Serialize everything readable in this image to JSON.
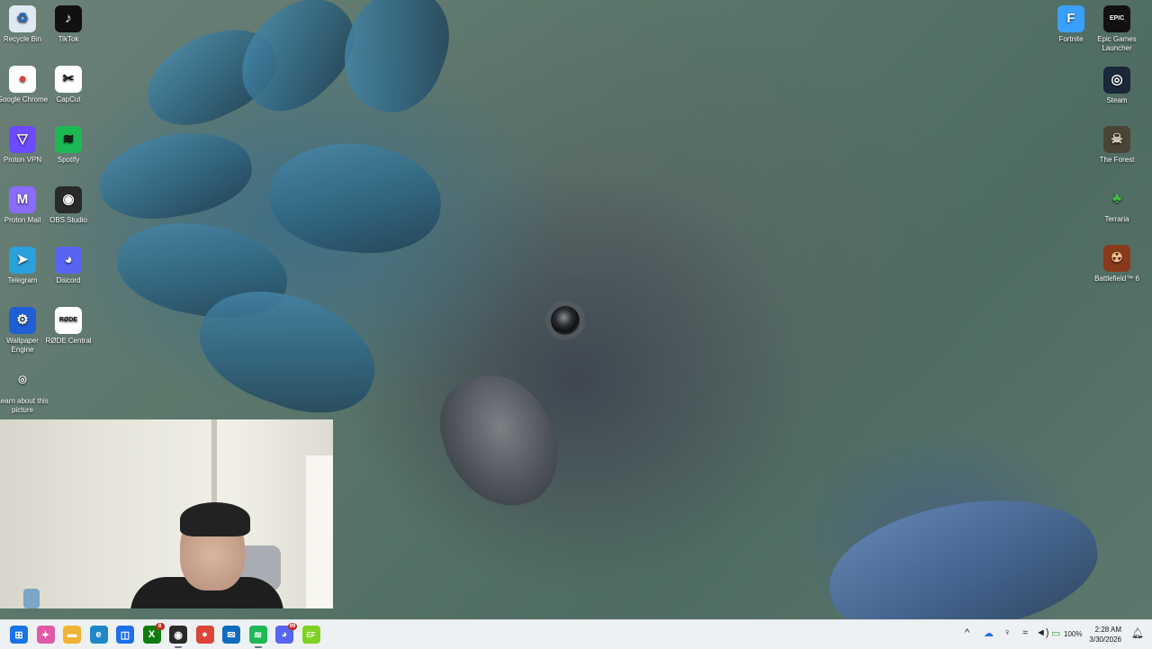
{
  "desktop": {
    "icons_left": [
      {
        "label": "Recycle Bin",
        "icon": "recycle-bin-icon",
        "glyph": "♻",
        "bg": "#dfe9f3",
        "fg": "#2b6cb0"
      },
      {
        "label": "TikTok",
        "icon": "tiktok-icon",
        "glyph": "♪",
        "bg": "#111111",
        "fg": "#ffffff"
      },
      {
        "label": "Google Chrome",
        "icon": "chrome-icon",
        "glyph": "●",
        "bg": "#ffffff",
        "fg": "#db4437"
      },
      {
        "label": "CapCut",
        "icon": "capcut-icon",
        "glyph": "✂",
        "bg": "#ffffff",
        "fg": "#111111"
      },
      {
        "label": "Proton VPN",
        "icon": "proton-vpn-icon",
        "glyph": "▽",
        "bg": "#6d4aff",
        "fg": "#ffffff"
      },
      {
        "label": "Spotify",
        "icon": "spotify-icon",
        "glyph": "≋",
        "bg": "#1db954",
        "fg": "#111111"
      },
      {
        "label": "Proton Mail",
        "icon": "proton-mail-icon",
        "glyph": "M",
        "bg": "#8a6cff",
        "fg": "#ffffff"
      },
      {
        "label": "OBS Studio",
        "icon": "obs-studio-icon",
        "glyph": "◉",
        "bg": "#2a2a2a",
        "fg": "#ffffff"
      },
      {
        "label": "Telegram",
        "icon": "telegram-icon",
        "glyph": "➤",
        "bg": "#2aa1da",
        "fg": "#ffffff"
      },
      {
        "label": "Discord",
        "icon": "discord-icon",
        "glyph": "◕",
        "bg": "#5865f2",
        "fg": "#ffffff"
      },
      {
        "label": "Wallpaper Engine",
        "icon": "wallpaper-engine-icon",
        "glyph": "⚙",
        "bg": "#1f5fd6",
        "fg": "#ffffff"
      },
      {
        "label": "RØDE Central",
        "icon": "rode-central-icon",
        "glyph": "RØDE",
        "bg": "#ffffff",
        "fg": "#111111"
      },
      {
        "label": "Learn about this picture",
        "icon": "learn-about-picture-icon",
        "glyph": "⌾",
        "bg": "transparent",
        "fg": "#ffffff"
      }
    ],
    "icons_right": [
      {
        "label": "Fortnite",
        "icon": "fortnite-icon",
        "glyph": "F",
        "bg": "#3aa0ff",
        "fg": "#ffffff"
      },
      {
        "label": "Epic Games Launcher",
        "icon": "epic-games-icon",
        "glyph": "EPIC",
        "bg": "#111111",
        "fg": "#ffffff"
      },
      {
        "label": "Steam",
        "icon": "steam-icon",
        "glyph": "◎",
        "bg": "#1b2838",
        "fg": "#ffffff"
      },
      {
        "label": "The Forest",
        "icon": "the-forest-icon",
        "glyph": "☠",
        "bg": "#4a4436",
        "fg": "#d9d2bc"
      },
      {
        "label": "Terraria",
        "icon": "terraria-icon",
        "glyph": "♣",
        "bg": "transparent",
        "fg": "#3fbf3f"
      },
      {
        "label": "Battlefield™ 6",
        "icon": "battlefield-icon",
        "glyph": "☢",
        "bg": "#8a3a1c",
        "fg": "#f2c28a"
      }
    ]
  },
  "taskbar": {
    "apps": [
      {
        "name": "start-button",
        "icon": "windows-icon",
        "glyph": "⊞",
        "bg": "#1a73e8",
        "open": false
      },
      {
        "name": "copilot-button",
        "icon": "copilot-icon",
        "glyph": "✦",
        "bg": "#e05aa8",
        "open": false
      },
      {
        "name": "file-explorer-button",
        "icon": "folder-icon",
        "glyph": "▬",
        "bg": "#f2b233",
        "open": false
      },
      {
        "name": "edge-button",
        "icon": "edge-icon",
        "glyph": "e",
        "bg": "#1e88c7",
        "open": false
      },
      {
        "name": "microsoft-store-button",
        "icon": "store-icon",
        "glyph": "◫",
        "bg": "#1f6feb",
        "open": false
      },
      {
        "name": "xbox-button",
        "icon": "xbox-icon",
        "glyph": "X",
        "bg": "#107c10",
        "open": false,
        "badge": "8"
      },
      {
        "name": "obs-taskbar-button",
        "icon": "obs-studio-icon",
        "glyph": "◉",
        "bg": "#2a2a2a",
        "open": true
      },
      {
        "name": "chrome-taskbar-button",
        "icon": "chrome-icon",
        "glyph": "●",
        "bg": "#db4437",
        "open": false
      },
      {
        "name": "outlook-button",
        "icon": "outlook-icon",
        "glyph": "✉",
        "bg": "#0f6cbd",
        "open": false
      },
      {
        "name": "spotify-taskbar-button",
        "icon": "spotify-icon",
        "glyph": "≋",
        "bg": "#1db954",
        "open": true
      },
      {
        "name": "discord-taskbar-button",
        "icon": "discord-icon",
        "glyph": "◕",
        "bg": "#5865f2",
        "open": false,
        "badge": "99"
      },
      {
        "name": "app-taskbar-button",
        "icon": "app-icon",
        "glyph": "EF",
        "bg": "#7ed321",
        "open": false
      }
    ],
    "tray": {
      "chevron": "^",
      "battery": "100%",
      "time": "2:28 AM",
      "date": "3/30/2026"
    }
  }
}
